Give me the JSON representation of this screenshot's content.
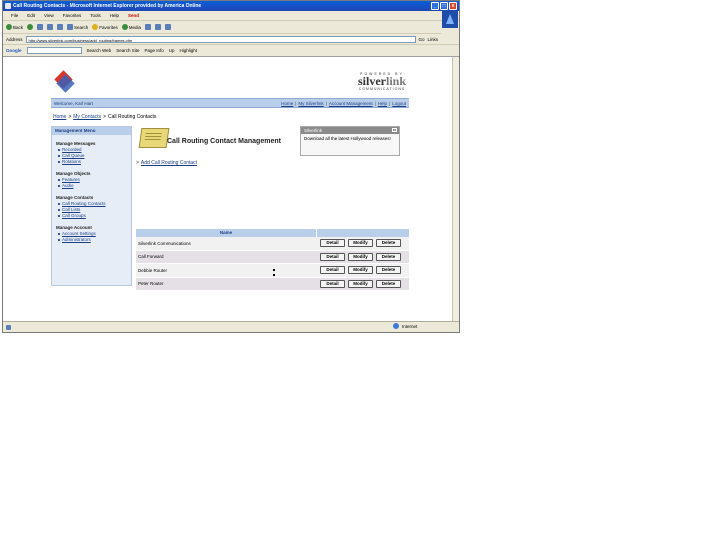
{
  "window": {
    "title": "Call Routing Contacts - Microsoft Internet Explorer provided by America Online",
    "controls": {
      "minimize": "_",
      "maximize": "□",
      "close": "x"
    }
  },
  "menu": {
    "items": [
      "File",
      "Edit",
      "View",
      "Favorites",
      "Tools",
      "Help"
    ],
    "aol_label": "Send"
  },
  "toolbar": {
    "back": "Back",
    "search": "Search",
    "favorites": "Favorites",
    "media": "Media"
  },
  "address": {
    "label": "Address",
    "url": "http://www.silverlink.com/business/add_routing/frames.cfm",
    "go": "Go",
    "links": "Links"
  },
  "google_bar": {
    "logo": "Google",
    "search_web": "Search Web",
    "search_site": "Search Site",
    "page_info": "Page Info",
    "up": "Up",
    "highlight": "Highlight"
  },
  "page": {
    "brand": {
      "powered": "POWERED BY",
      "name_a": "silver",
      "name_b": "link",
      "sub": "COMMUNICATIONS"
    },
    "welcome": "Welcome, Karl Hart",
    "top_links": [
      "Home",
      "My Silverlink",
      "Account Management",
      "Help",
      "Logout"
    ],
    "breadcrumb": [
      "Home",
      "My Contacts",
      "Call Routing Contacts"
    ],
    "sidebar": {
      "heading": "Management Menu",
      "groups": [
        {
          "title": "Manage Messages",
          "items": [
            "Recorded",
            "Call Queue",
            "Rotations"
          ]
        },
        {
          "title": "Manage Objects",
          "items": [
            "Features",
            "Audio"
          ]
        },
        {
          "title": "Manage Contacts",
          "items": [
            "Call Routing Contacts",
            "Call Lists",
            "Call Groups"
          ]
        },
        {
          "title": "Manage Account",
          "items": [
            "Account Settings",
            "Administrators"
          ]
        }
      ]
    },
    "main": {
      "title": "Call Routing Contact Management",
      "notice": {
        "heading": "Silverlink",
        "body": "Download all the latest Hollywood releases!"
      },
      "add_link": "Add Call Routing Contact",
      "table": {
        "header": "Name",
        "rows": [
          {
            "name": "Silverlink Communications"
          },
          {
            "name": "Call Forward"
          },
          {
            "name": "Debbie Router"
          },
          {
            "name": "Peter Router"
          }
        ],
        "actions": [
          "Detail",
          "Modify",
          "Delete"
        ]
      }
    }
  },
  "status": {
    "zone": "Internet"
  }
}
